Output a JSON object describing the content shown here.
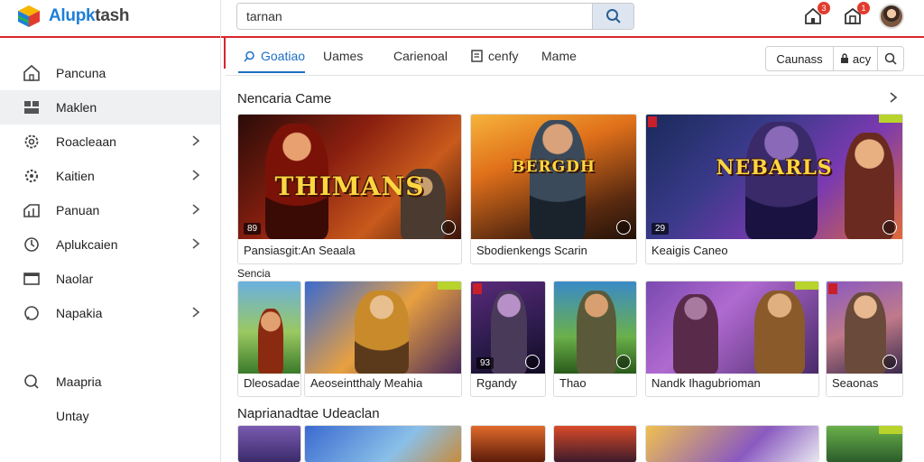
{
  "app": {
    "logo_part1": "Alu",
    "logo_part2": "pk",
    "logo_part3": "tash"
  },
  "search": {
    "value": "tarnan"
  },
  "top_icons": {
    "home_badge": "3",
    "store_badge": "1"
  },
  "sidebar": {
    "items": [
      {
        "label": "Pancuna",
        "icon": "home-icon",
        "chevron": false
      },
      {
        "label": "Maklen",
        "icon": "grid-icon",
        "chevron": false,
        "active": true
      },
      {
        "label": "Roacleaan",
        "icon": "gear-icon",
        "chevron": true
      },
      {
        "label": "Kaitien",
        "icon": "cog-icon",
        "chevron": true
      },
      {
        "label": "Panuan",
        "icon": "chart-icon",
        "chevron": true
      },
      {
        "label": "Aplukcaien",
        "icon": "clock-icon",
        "chevron": true
      },
      {
        "label": "Naolar",
        "icon": "window-icon",
        "chevron": false
      },
      {
        "label": "Napakia",
        "icon": "chat-icon",
        "chevron": true
      }
    ],
    "lower": [
      {
        "label": "Maapria",
        "icon": "search-icon"
      },
      {
        "label": "Untay"
      }
    ]
  },
  "tabs": [
    {
      "label": "Goatiao",
      "active": true
    },
    {
      "label": "Uames"
    },
    {
      "label": "Carienoal"
    },
    {
      "label": "cenfy"
    },
    {
      "label": "Mame"
    }
  ],
  "filter": {
    "option1": "Caunass",
    "option2": "acy"
  },
  "sections": {
    "featured_title": "Nencaria Came",
    "row2_title": "Sencia",
    "row3_title": "Naprianadtae Udeaclan"
  },
  "featured_cards": [
    {
      "label": "Pansiasgit:An Seaala",
      "art_title": "THIMANS",
      "badge": "89"
    },
    {
      "label": "Sbodienkengs Scarin",
      "art_title": "BERGDH",
      "badge": ""
    },
    {
      "label": "Keaigis Caneo",
      "art_title": "NEBARLS",
      "badge": "29"
    }
  ],
  "row2_cards": [
    {
      "label": "Dleosadae"
    },
    {
      "label": "Aeoseintthaly Meahia"
    },
    {
      "label": "Rgandy",
      "badge": "93"
    },
    {
      "label": "Thao"
    },
    {
      "label": "Nandk Ihagubrioman"
    },
    {
      "label": "Seaonas"
    }
  ]
}
